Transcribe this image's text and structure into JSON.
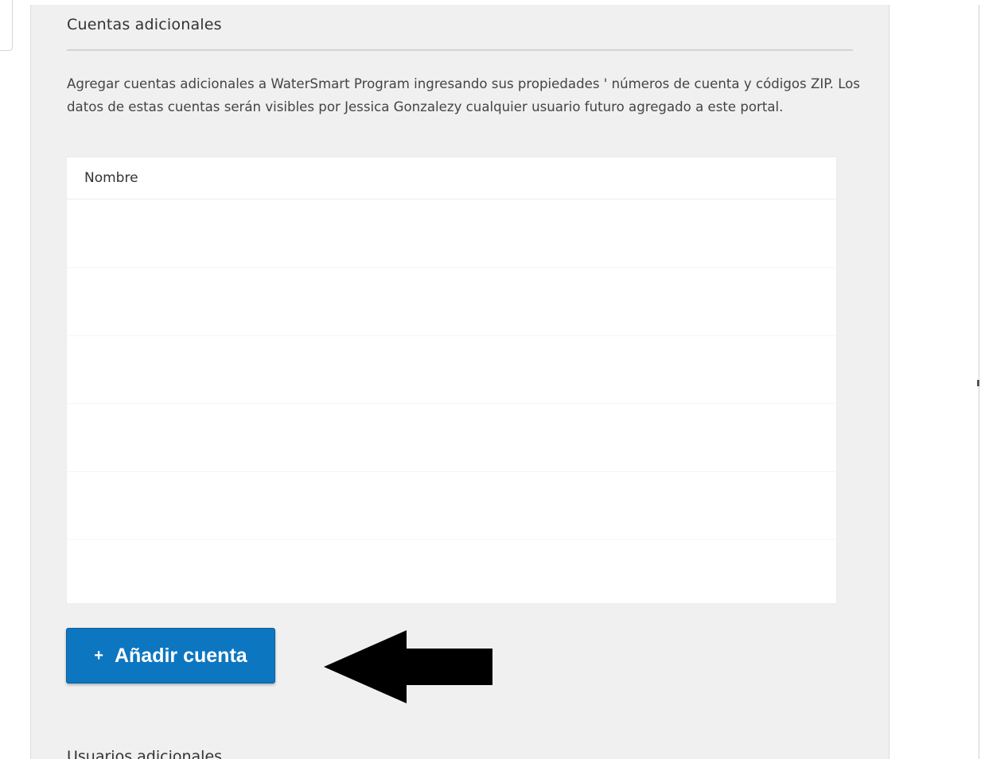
{
  "additional_accounts": {
    "title": "Cuentas adicionales",
    "description": "Agregar cuentas adicionales a WaterSmart Program ingresando sus propiedades ' números de cuenta y códigos ZIP. Los datos de estas cuentas serán visibles por Jessica Gonzalezy cualquier usuario futuro agregado a este portal.",
    "table": {
      "columns": [
        "Nombre"
      ],
      "rows": []
    },
    "add_button": {
      "icon": "plus-icon",
      "label": "Añadir cuenta"
    },
    "annotation": {
      "icon": "arrow-left-icon",
      "color": "#000000"
    }
  },
  "additional_users": {
    "title": "Usuarios adicionales"
  },
  "colors": {
    "panel_background": "#f0f0f0",
    "button_background": "#0d76c0",
    "button_text": "#ffffff"
  }
}
